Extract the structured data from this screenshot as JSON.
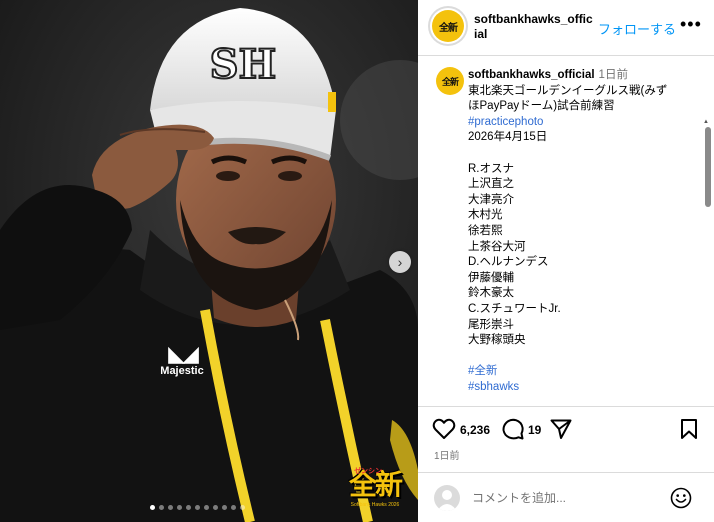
{
  "post": {
    "username": "softbankhawks_official",
    "follow_label": "フォローする",
    "more_label": "•••",
    "avatar_text": "全新",
    "caption": {
      "username": "softbankhawks_official",
      "time": "1日前",
      "lines": [
        "東北楽天ゴールデンイーグルス戦(みず",
        "ほPayPayドーム)試合前練習"
      ],
      "hashtag_top": "#practicephoto",
      "date": "2026年4月15日",
      "players": [
        "R.オスナ",
        "上沢直之",
        "大津亮介",
        "木村光",
        "徐若熙",
        "上茶谷大河",
        "D.ヘルナンデス",
        "伊藤優輔",
        "鈴木豪太",
        "C.スチュワートJr.",
        "尾形崇斗",
        "大野稼頭央"
      ],
      "hashtags_bottom": [
        "#全新",
        "#sbhawks"
      ]
    },
    "likes": "6,236",
    "comments": "19",
    "posted_ago": "1日前",
    "comment_placeholder": "コメントを追加..."
  },
  "media": {
    "cap_logo_text": "SH",
    "brand_text": "Majestic",
    "watermark_main": "全新",
    "watermark_top": "ゼンシン",
    "watermark_sub": "Softbank Hawks 2026",
    "slide_count": 11,
    "active_slide": 0
  },
  "icons": {
    "next": "chevron-right-icon",
    "like": "heart-icon",
    "comment": "comment-bubble-icon",
    "share": "paper-plane-icon",
    "save": "bookmark-icon",
    "emoji": "smiley-icon",
    "more": "more-dots-icon"
  },
  "colors": {
    "link": "#0095f6",
    "hashtag": "#2f6bd1",
    "brand_yellow": "#f4c20d",
    "muted": "#737373"
  }
}
